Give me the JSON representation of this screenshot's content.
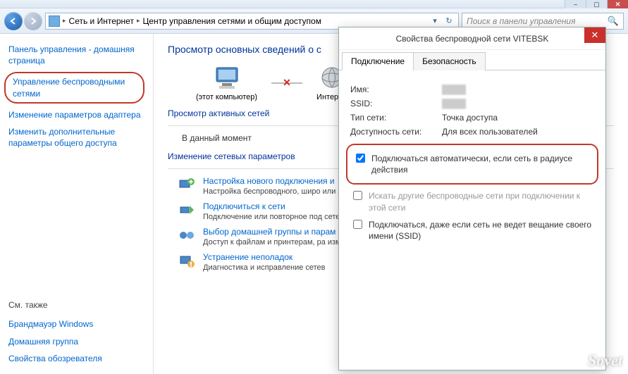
{
  "window": {
    "search_placeholder": "Поиск в панели управления"
  },
  "breadcrumb": {
    "part1": "Сеть и Интернет",
    "part2": "Центр управления сетями и общим доступом"
  },
  "sidebar": {
    "home": "Панель управления - домашняя страница",
    "wireless": "Управление беспроводными сетями",
    "adapter": "Изменение параметров адаптера",
    "sharing": "Изменить дополнительные параметры общего доступа",
    "see_also": "См. также",
    "firewall": "Брандмауэр Windows",
    "homegroup": "Домашняя группа",
    "ie": "Свойства обозревателя"
  },
  "content": {
    "title": "Просмотр основных сведений о с",
    "this_pc": "(этот компьютер)",
    "internet": "Интерне",
    "active_nets": "Просмотр активных сетей",
    "no_active": "В данный момент",
    "change_settings": "Изменение сетевых параметров",
    "task1": {
      "link": "Настройка нового подключения и",
      "desc": "Настройка беспроводного, широ\nили же настройка маршрутизатор"
    },
    "task2": {
      "link": "Подключиться к сети",
      "desc": "Подключение или повторное под\nсетевому соединению или подклю"
    },
    "task3": {
      "link": "Выбор домашней группы и парам",
      "desc": "Доступ к файлам и принтерам, ра\nизменение параметров общего до"
    },
    "task4": {
      "link": "Устранение неполадок",
      "desc": "Диагностика и исправление сетев"
    }
  },
  "dialog": {
    "title": "Свойства беспроводной сети VITEBSK",
    "tabs": {
      "connection": "Подключение",
      "security": "Безопасность"
    },
    "props": {
      "name_label": "Имя:",
      "ssid_label": "SSID:",
      "type_label": "Тип сети:",
      "type_value": "Точка доступа",
      "avail_label": "Доступность сети:",
      "avail_value": "Для всех пользователей"
    },
    "cb_auto": "Подключаться автоматически, если сеть в радиусе действия",
    "cb_other": "Искать другие беспроводные сети при подключении к этой сети",
    "cb_hidden": "Подключаться, даже если сеть не ведет вещание своего имени (SSID)"
  },
  "watermark": "Sovet"
}
